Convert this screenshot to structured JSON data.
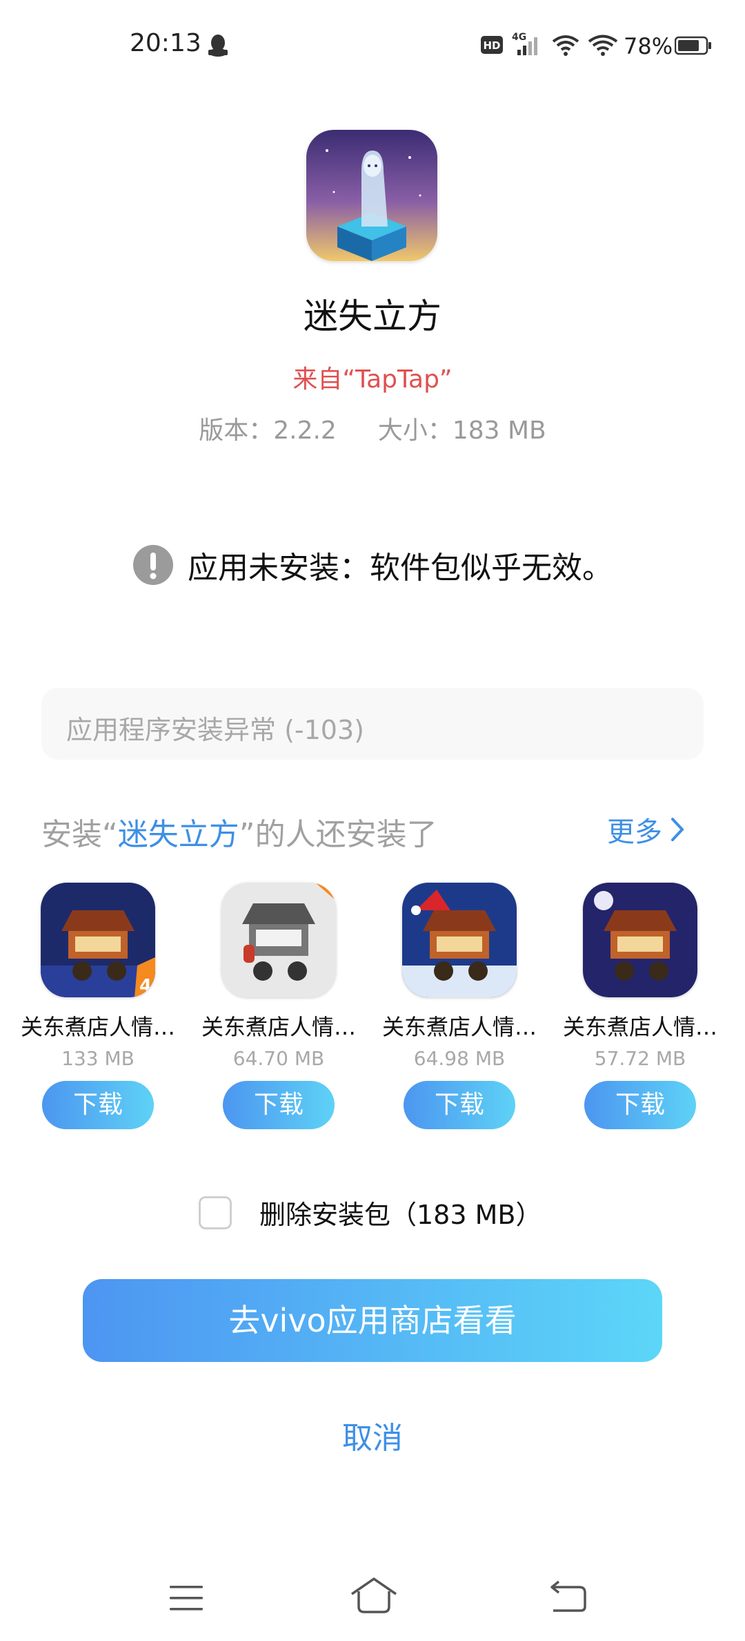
{
  "status_bar": {
    "time": "20:13",
    "battery_percent": "78%",
    "icons": [
      "qq-icon",
      "hd-icon",
      "signal-4g-icon",
      "wifi-icon",
      "wifi-icon",
      "battery-icon"
    ]
  },
  "app": {
    "name": "迷失立方",
    "source": "来自“TapTap”",
    "version": "版本：2.2.2",
    "size": "大小：183 MB"
  },
  "error": {
    "message": "应用未安装：软件包似乎无效。",
    "detail": "应用程序安装异常 (-103)"
  },
  "recommendations": {
    "title_prefix": "安装“",
    "title_app": "迷失立方",
    "title_suffix": "”的人还安装了",
    "more_label": "更多",
    "items": [
      {
        "name": "关东煮店人情…",
        "size": "133 MB",
        "button": "下载"
      },
      {
        "name": "关东煮店人情…",
        "size": "64.70 MB",
        "button": "下载"
      },
      {
        "name": "关东煮店人情…",
        "size": "64.98 MB",
        "button": "下载"
      },
      {
        "name": "关东煮店人情…",
        "size": "57.72 MB",
        "button": "下载"
      }
    ]
  },
  "delete_package": {
    "label": "删除安装包（183 MB）",
    "checked": false
  },
  "actions": {
    "store_button": "去vivo应用商店看看",
    "cancel_button": "取消"
  },
  "colors": {
    "accent_blue": "#3e8fe6",
    "source_red": "#e05050",
    "button_gradient_start": "#4d95f2",
    "button_gradient_end": "#5cd6f8"
  }
}
